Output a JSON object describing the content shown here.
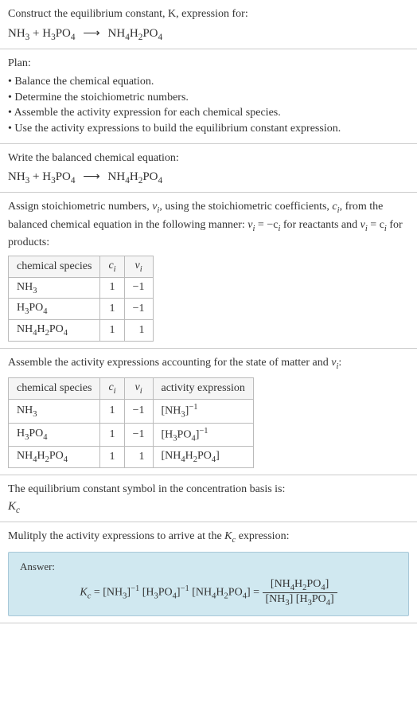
{
  "header": {
    "title_line1": "Construct the equilibrium constant, K, expression for:",
    "equation_lhs1": "NH",
    "equation_lhs1_sub": "3",
    "equation_plus1": " + H",
    "equation_lhs2_sub": "3",
    "equation_lhs2b": "PO",
    "equation_lhs2b_sub": "4",
    "equation_arrow": "⟶",
    "equation_rhs": "NH",
    "equation_rhs_sub1": "4",
    "equation_rhs2": "H",
    "equation_rhs_sub2": "2",
    "equation_rhs3": "PO",
    "equation_rhs_sub3": "4"
  },
  "plan": {
    "title": "Plan:",
    "items": [
      "• Balance the chemical equation.",
      "• Determine the stoichiometric numbers.",
      "• Assemble the activity expression for each chemical species.",
      "• Use the activity expressions to build the equilibrium constant expression."
    ]
  },
  "balanced": {
    "title": "Write the balanced chemical equation:"
  },
  "stoich": {
    "para1": "Assign stoichiometric numbers, ",
    "para1_var": "ν",
    "para1_sub": "i",
    "para1b": ", using the stoichiometric coefficients, ",
    "para1_var2": "c",
    "para1_sub2": "i",
    "para1c": ", from the balanced chemical equation in the following manner: ",
    "para1_eq1": "ν",
    "para1_eq1_sub": "i",
    "para1_eq1b": " = −c",
    "para1_eq1b_sub": "i",
    "para1d": " for reactants and ",
    "para1_eq2": "ν",
    "para1_eq2_sub": "i",
    "para1_eq2b": " = c",
    "para1_eq2b_sub": "i",
    "para1e": " for products:",
    "table": {
      "headers": [
        "chemical species",
        "cᵢ",
        "νᵢ"
      ],
      "h0": "chemical species",
      "h1_var": "c",
      "h1_sub": "i",
      "h2_var": "ν",
      "h2_sub": "i",
      "rows": [
        {
          "species_a": "NH",
          "species_a_sub": "3",
          "species_b": "",
          "species_b_sub": "",
          "species_c": "",
          "species_c_sub": "",
          "ci": "1",
          "vi": "−1"
        },
        {
          "species_a": "H",
          "species_a_sub": "3",
          "species_b": "PO",
          "species_b_sub": "4",
          "species_c": "",
          "species_c_sub": "",
          "ci": "1",
          "vi": "−1"
        },
        {
          "species_a": "NH",
          "species_a_sub": "4",
          "species_b": "H",
          "species_b_sub": "2",
          "species_c": "PO",
          "species_c_sub": "4",
          "ci": "1",
          "vi": "1"
        }
      ]
    }
  },
  "activity": {
    "para": "Assemble the activity expressions accounting for the state of matter and ",
    "para_var": "ν",
    "para_sub": "i",
    "para_end": ":",
    "table": {
      "h0": "chemical species",
      "h1_var": "c",
      "h1_sub": "i",
      "h2_var": "ν",
      "h2_sub": "i",
      "h3": "activity expression",
      "rows": [
        {
          "species_a": "NH",
          "species_a_sub": "3",
          "species_b": "",
          "species_b_sub": "",
          "species_c": "",
          "species_c_sub": "",
          "ci": "1",
          "vi": "−1",
          "act_pre": "[NH",
          "act_sub1": "3",
          "act_mid": "]",
          "act_sup": "−1",
          "act_b": "",
          "act_sub2": "",
          "act_c": "",
          "act_sub3": "",
          "act_end": ""
        },
        {
          "species_a": "H",
          "species_a_sub": "3",
          "species_b": "PO",
          "species_b_sub": "4",
          "species_c": "",
          "species_c_sub": "",
          "ci": "1",
          "vi": "−1",
          "act_pre": "[H",
          "act_sub1": "3",
          "act_mid": "PO",
          "act_sup": "",
          "act_b": "",
          "act_sub2": "4",
          "act_c": "]",
          "act_sub3": "",
          "act_end": "",
          "act_sup2": "−1"
        },
        {
          "species_a": "NH",
          "species_a_sub": "4",
          "species_b": "H",
          "species_b_sub": "2",
          "species_c": "PO",
          "species_c_sub": "4",
          "ci": "1",
          "vi": "1",
          "act_pre": "[NH",
          "act_sub1": "4",
          "act_mid": "H",
          "act_sup": "",
          "act_b": "",
          "act_sub2": "2",
          "act_c": "PO",
          "act_sub3": "4",
          "act_end": "]"
        }
      ]
    }
  },
  "symbol": {
    "para": "The equilibrium constant symbol in the concentration basis is:",
    "var": "K",
    "sub": "c"
  },
  "multiply": {
    "para1": "Mulitply the activity expressions to arrive at the ",
    "para_var": "K",
    "para_sub": "c",
    "para2": " expression:"
  },
  "answer": {
    "label": "Answer:",
    "Kc_var": "K",
    "Kc_sub": "c",
    "eq": " = [NH",
    "s1": "3",
    "eq2": "]",
    "sup1": "−1",
    "eq3": " [H",
    "s2": "3",
    "eq4": "PO",
    "s3": "4",
    "eq5": "]",
    "sup2": "−1",
    "eq6": " [NH",
    "s4": "4",
    "eq7": "H",
    "s5": "2",
    "eq8": "PO",
    "s6": "4",
    "eq9": "] = ",
    "num1": "[NH",
    "ns1": "4",
    "num2": "H",
    "ns2": "2",
    "num3": "PO",
    "ns3": "4",
    "num4": "]",
    "den1": "[NH",
    "ds1": "3",
    "den2": "] [H",
    "ds2": "3",
    "den3": "PO",
    "ds3": "4",
    "den4": "]"
  }
}
